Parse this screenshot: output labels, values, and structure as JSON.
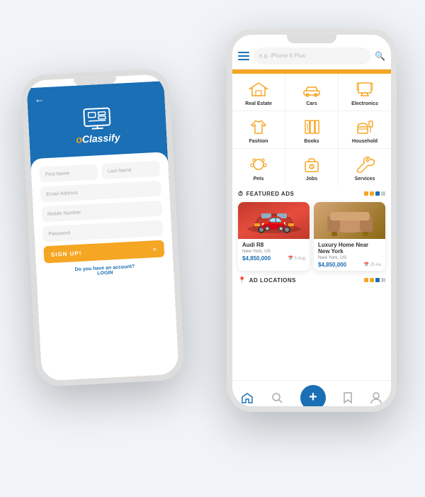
{
  "app": {
    "name_prefix": "o",
    "name_main": "Classify",
    "tagline": "oClassify"
  },
  "left_phone": {
    "back_arrow": "←",
    "fields": {
      "first_name": "First Name",
      "last_name": "Last Name",
      "email": "Email Address",
      "mobile": "Mobile Number",
      "password": "Password"
    },
    "signup_button": "SIGN UP!",
    "account_prompt": "Do you have an account?",
    "login_link": "LOGIN"
  },
  "right_phone": {
    "search_placeholder": "e.g. iPhone 6 Plus",
    "categories": [
      {
        "id": "real-estate",
        "label": "Real Estate"
      },
      {
        "id": "cars",
        "label": "Cars"
      },
      {
        "id": "electronics",
        "label": "Electronics"
      },
      {
        "id": "fashion",
        "label": "Fashion"
      },
      {
        "id": "books",
        "label": "Books"
      },
      {
        "id": "household",
        "label": "Household"
      },
      {
        "id": "pets",
        "label": "Pets"
      },
      {
        "id": "jobs",
        "label": "Jobs"
      },
      {
        "id": "services",
        "label": "Services"
      }
    ],
    "featured_ads_title": "FEATURED ADS",
    "ads": [
      {
        "title": "Audi R8",
        "location": "New York, US",
        "price": "$4,850,000",
        "date": "5 Aug",
        "type": "car"
      },
      {
        "title": "Luxury Home Near New York",
        "location": "New York, US",
        "price": "$4,850,000",
        "date": "25 Au",
        "type": "sofa"
      }
    ],
    "ad_locations_title": "AD LOCATIONS",
    "nav": {
      "home": "🏠",
      "search": "🔍",
      "add": "+",
      "bookmark": "🔖",
      "profile": "👤"
    }
  },
  "colors": {
    "blue": "#1a6fb5",
    "orange": "#f5a623",
    "white": "#ffffff",
    "light_gray": "#f5f5f5"
  }
}
